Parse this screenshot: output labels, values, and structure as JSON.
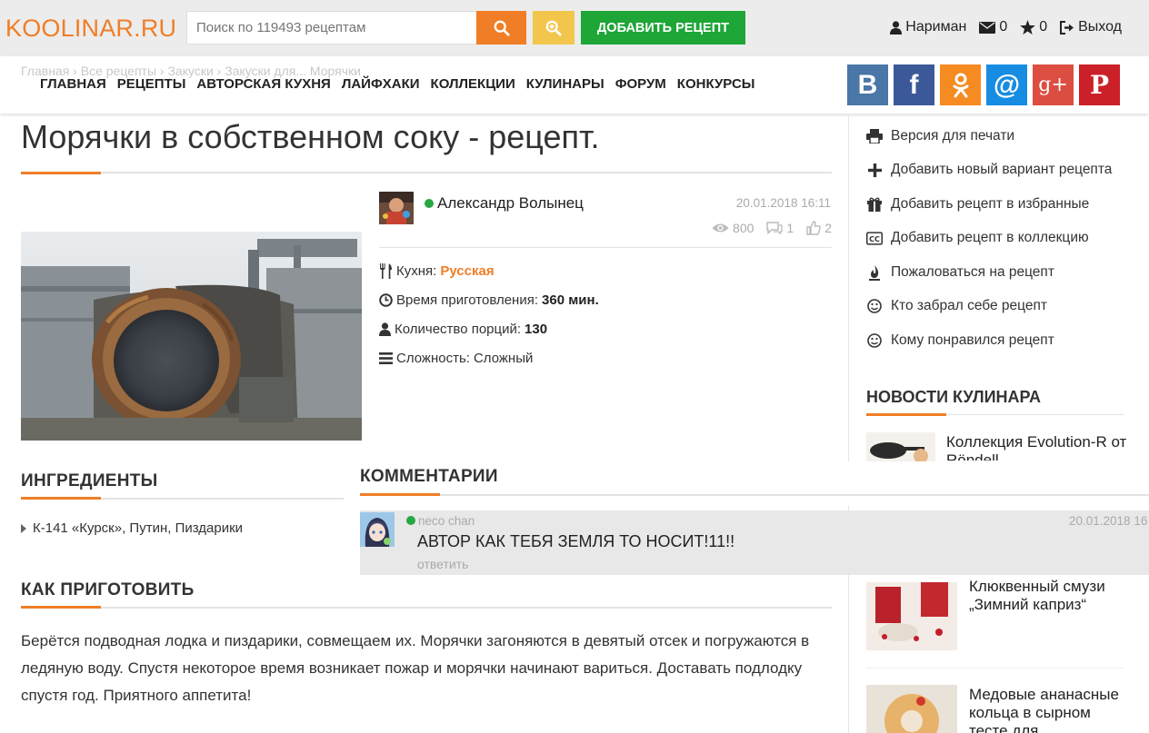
{
  "header": {
    "logo": "KOOLINAR.RU",
    "search_placeholder": "Поиск по 119493 рецептам",
    "add_recipe": "ДОБАВИТЬ РЕЦЕПТ",
    "user_name": "Нариман",
    "messages_count": "0",
    "favorites_count": "0",
    "logout": "Выход"
  },
  "nav": {
    "breadcrumb": "Главная › Все рецепты › Закуски › Закуски для... Морячки",
    "menu": [
      "ГЛАВНАЯ",
      "РЕЦЕПТЫ",
      "АВТОРСКАЯ КУХНЯ",
      "ЛАЙФХАКИ",
      "КОЛЛЕКЦИИ",
      "КУЛИНАРЫ",
      "ФОРУМ",
      "КОНКУРСЫ"
    ],
    "social": [
      "В",
      "f",
      "ok",
      "@",
      "g+",
      "P"
    ]
  },
  "recipe": {
    "title": "Морячки в собственном соку - рецепт.",
    "author": "Александр Волынец",
    "date": "20.01.2018 16:11",
    "views": "800",
    "comments": "1",
    "likes": "2",
    "cuisine_label": "Кухня:",
    "cuisine": "Русская",
    "time_label": "Время приготовления:",
    "time": "360 мин.",
    "portions_label": "Количество порций:",
    "portions": "130",
    "difficulty_label": "Сложность:",
    "difficulty": "Сложный"
  },
  "ingredients": {
    "title": "ИНГРЕДИЕНТЫ",
    "items": [
      "К-141 «Курск», Путин, Пиздарики"
    ]
  },
  "howto": {
    "title": "КАК ПРИГОТОВИТЬ",
    "text": "Берётся подводная лодка и пиздарики, совмещаем их. Морячки загоняются в девятый отсек и погружаются в ледяную воду. Спустя некоторое время возникает пожар и морячки начинают вариться. Доставать подлодку спустя год. Приятного аппетита!"
  },
  "comments": {
    "title": "КОММЕНТАРИИ",
    "items": [
      {
        "author": "neco chan",
        "date": "20.01.2018 16",
        "text": "АВТОР КАК ТЕБЯ ЗЕМЛЯ ТО НОСИТ!11!!",
        "reply": "ответить"
      }
    ]
  },
  "sidebar": {
    "actions": [
      {
        "icon": "printer-icon",
        "label": "Версия для печати"
      },
      {
        "icon": "plus-icon",
        "label": "Добавить новый вариант рецепта"
      },
      {
        "icon": "gift-icon",
        "label": "Добавить рецепт в избранные"
      },
      {
        "icon": "cc-icon",
        "label": "Добавить рецепт в коллекцию"
      },
      {
        "icon": "fire-icon",
        "label": "Пожаловаться на рецепт"
      },
      {
        "icon": "smile-icon",
        "label": "Кто забрал себе рецепт"
      },
      {
        "icon": "smile-icon",
        "label": "Кому понравился рецепт"
      }
    ],
    "news_title": "НОВОСТИ КУЛИНАРА",
    "news": [
      {
        "title": "Коллекция Evolution-R от Röndell"
      },
      {
        "title": "Клюквенный смузи „Зимний каприз“"
      },
      {
        "title": "Медовые ананасные кольца в сырном тесте для"
      }
    ]
  },
  "colors": {
    "accent": "#f07e26",
    "green": "#1ea637",
    "yellow": "#f2c64d",
    "vk": "#4a76a8",
    "fb": "#3b5998",
    "ok": "#f58b21",
    "mail": "#168de2",
    "gplus": "#dc4e41",
    "pinterest": "#cb2027"
  }
}
